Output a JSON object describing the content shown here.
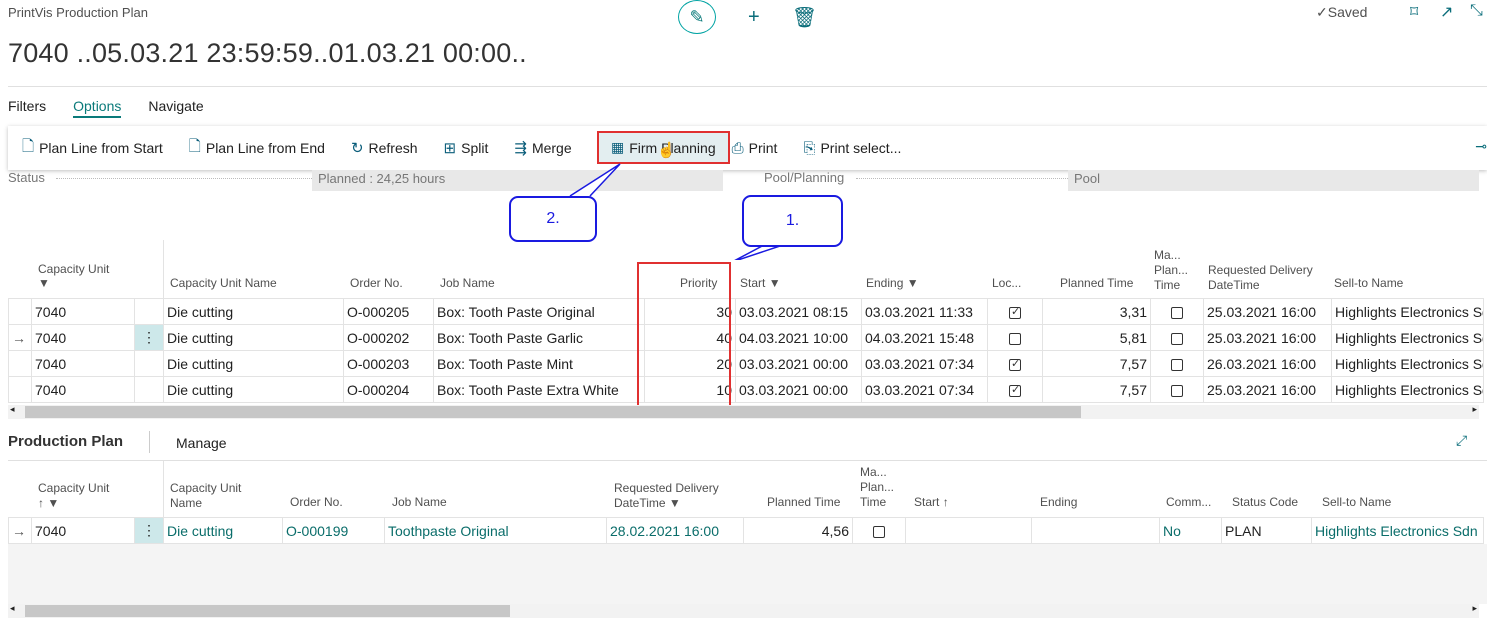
{
  "caption": "PrintVis Production Plan",
  "title": "7040 ..05.03.21 23:59:59..01.03.21 00:00..",
  "saved": "Saved",
  "icons": {
    "edit": "pencil-icon",
    "new": "plus-icon",
    "delete": "trash-icon",
    "bookmark": "bookmark-icon",
    "open": "open-new-window-icon",
    "collapse": "collapse-icon"
  },
  "tabs": [
    "Filters",
    "Options",
    "Navigate"
  ],
  "toolbar": [
    "Plan Line from Start",
    "Plan Line from End",
    "Refresh",
    "Split",
    "Merge",
    "Firm Planning",
    "Print",
    "Print select..."
  ],
  "status": {
    "label": "Status",
    "value": "Planned : 24,25 hours",
    "pool_label": "Pool/Planning",
    "pool_value": "Pool"
  },
  "callouts": [
    "1.",
    "2."
  ],
  "top_headers": {
    "cap_unit": "Capacity Unit",
    "cap_name": "Capacity Unit Name",
    "order": "Order No.",
    "job": "Job Name",
    "priority": "Priority",
    "start": "Start",
    "ending": "Ending",
    "locked": "Loc...",
    "planned": "Planned Time",
    "manual_l1": "Ma...",
    "manual_l2": "Plan...",
    "manual_l3": "Time",
    "req_l1": "Requested Delivery",
    "req_l2": "DateTime",
    "sellto": "Sell-to Name"
  },
  "top_rows": [
    {
      "unit": "7040",
      "name": "Die cutting",
      "order": "O-000205",
      "job": "Box: Tooth Paste Original",
      "priority": "30",
      "start": "03.03.2021 08:15",
      "ending": "03.03.2021 11:33",
      "locked": true,
      "planned": "3,31",
      "manual": false,
      "req": "25.03.2021 16:00",
      "sellto": "Highlights Electronics Sdn"
    },
    {
      "unit": "7040",
      "name": "Die cutting",
      "order": "O-000202",
      "job": "Box: Tooth Paste Garlic",
      "priority": "40",
      "start": "04.03.2021 10:00",
      "ending": "04.03.2021 15:48",
      "locked": false,
      "planned": "5,81",
      "manual": false,
      "req": "25.03.2021 16:00",
      "sellto": "Highlights Electronics Sdn"
    },
    {
      "unit": "7040",
      "name": "Die cutting",
      "order": "O-000203",
      "job": "Box: Tooth Paste Mint",
      "priority": "20",
      "start": "03.03.2021 00:00",
      "ending": "03.03.2021 07:34",
      "locked": true,
      "planned": "7,57",
      "manual": false,
      "req": "26.03.2021 16:00",
      "sellto": "Highlights Electronics Sdn"
    },
    {
      "unit": "7040",
      "name": "Die cutting",
      "order": "O-000204",
      "job": "Box: Tooth Paste Extra White",
      "priority": "10",
      "start": "03.03.2021 00:00",
      "ending": "03.03.2021 07:34",
      "locked": true,
      "planned": "7,57",
      "manual": false,
      "req": "25.03.2021 16:00",
      "sellto": "Highlights Electronics Sdn"
    }
  ],
  "bottom": {
    "title": "Production Plan",
    "manage": "Manage",
    "headers": {
      "cap_unit": "Capacity Unit",
      "cap_name_l1": "Capacity Unit",
      "cap_name_l2": "Name",
      "order": "Order No.",
      "job": "Job Name",
      "req_l1": "Requested Delivery",
      "req_l2": "DateTime",
      "planned": "Planned Time",
      "manual_l1": "Ma...",
      "manual_l2": "Plan...",
      "manual_l3": "Time",
      "start": "Start",
      "ending": "Ending",
      "comm": "Comm...",
      "status": "Status Code",
      "sellto": "Sell-to Name"
    },
    "row": {
      "unit": "7040",
      "name": "Die cutting",
      "order": "O-000199",
      "job": "Toothpaste Original",
      "req": "28.02.2021 16:00",
      "planned": "4,56",
      "manual": false,
      "start": "",
      "ending": "",
      "comm": "No",
      "status": "PLAN",
      "sellto": "Highlights Electronics Sdn"
    }
  }
}
